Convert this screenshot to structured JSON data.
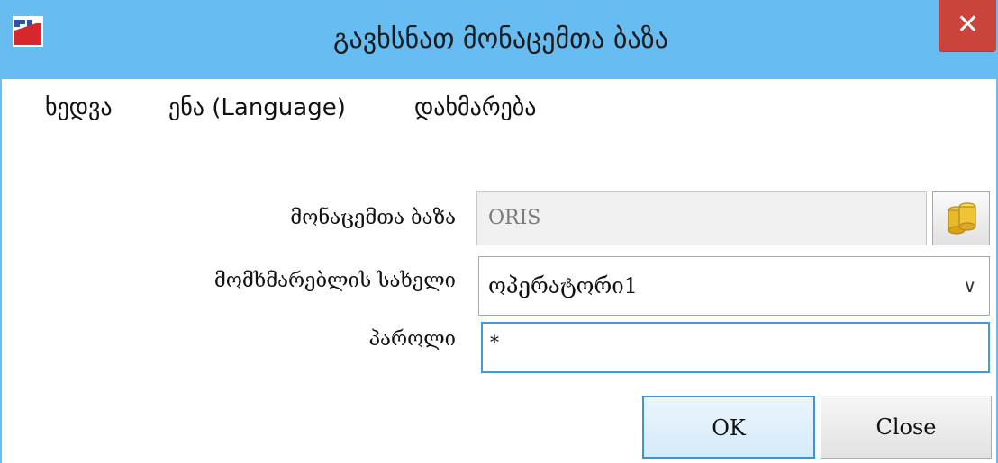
{
  "window": {
    "title": "გავხსნათ მონაცემთა ბაზა",
    "close_glyph": "✕",
    "titlebar_color": "#67bdf2",
    "close_color": "#c9443a"
  },
  "menu": {
    "items": [
      {
        "label": "ხედვა"
      },
      {
        "label": "ენა (Language)"
      },
      {
        "label": "დახმარება"
      }
    ]
  },
  "form": {
    "database": {
      "label": "მონაცემთა ბაზა",
      "value": "ORIS",
      "icon": "database-icon"
    },
    "username": {
      "label": "მომხმარებლის სახელი",
      "value": "ოპერატორი1"
    },
    "password": {
      "label": "პაროლი",
      "value": "*"
    }
  },
  "buttons": {
    "ok": "OK",
    "close": "Close"
  }
}
